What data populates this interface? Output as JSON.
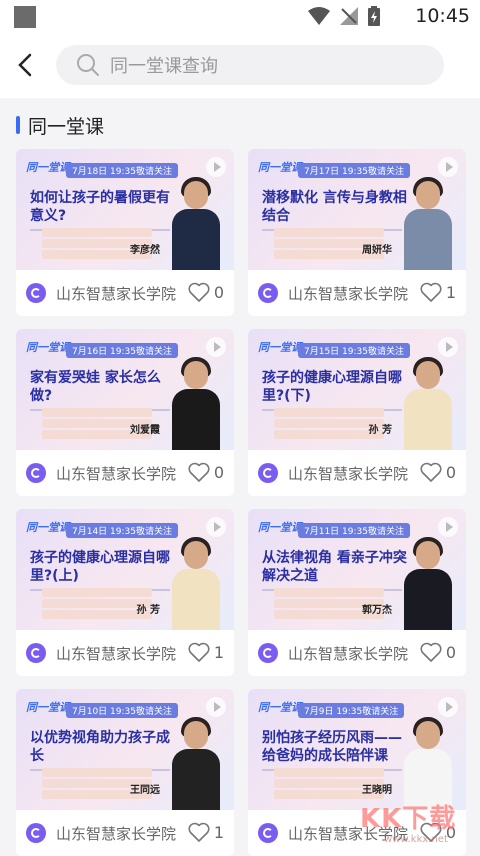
{
  "status_bar": {
    "time": "10:45"
  },
  "search": {
    "placeholder": "同一堂课查询"
  },
  "section": {
    "title": "同一堂课"
  },
  "courses": [
    {
      "date": "7月18日 19:35敬请关注",
      "title": "如何让孩子的暑假更有意义?",
      "speaker": "李彦然",
      "org": "山东智慧家长学院",
      "likes": "0"
    },
    {
      "date": "7月17日 19:35敬请关注",
      "title": "潜移默化 言传与身教相结合",
      "speaker": "周妍华",
      "org": "山东智慧家长学院",
      "likes": "1"
    },
    {
      "date": "7月16日 19:35敬请关注",
      "title": "家有爱哭娃 家长怎么做?",
      "speaker": "刘爱霞",
      "org": "山东智慧家长学院",
      "likes": "0"
    },
    {
      "date": "7月15日 19:35敬请关注",
      "title": "孩子的健康心理源自哪里?(下)",
      "speaker": "孙 芳",
      "org": "山东智慧家长学院",
      "likes": "0"
    },
    {
      "date": "7月14日 19:35敬请关注",
      "title": "孩子的健康心理源自哪里?(上)",
      "speaker": "孙 芳",
      "org": "山东智慧家长学院",
      "likes": "1"
    },
    {
      "date": "7月11日 19:35敬请关注",
      "title": "从法律视角 看亲子冲突解决之道",
      "speaker": "郭万杰",
      "org": "山东智慧家长学院",
      "likes": "0"
    },
    {
      "date": "7月10日 19:35敬请关注",
      "title": "以优势视角助力孩子成长",
      "speaker": "王同远",
      "org": "山东智慧家长学院",
      "likes": "1"
    },
    {
      "date": "7月9日 19:35敬请关注",
      "title": "别怕孩子经历风雨——给爸妈的成长陪伴课",
      "speaker": "王晓明",
      "org": "山东智慧家长学院",
      "likes": "0"
    }
  ],
  "thumb_logo": "同一堂课",
  "watermark": {
    "big": "KK下载",
    "small": "www.kkx.net"
  }
}
